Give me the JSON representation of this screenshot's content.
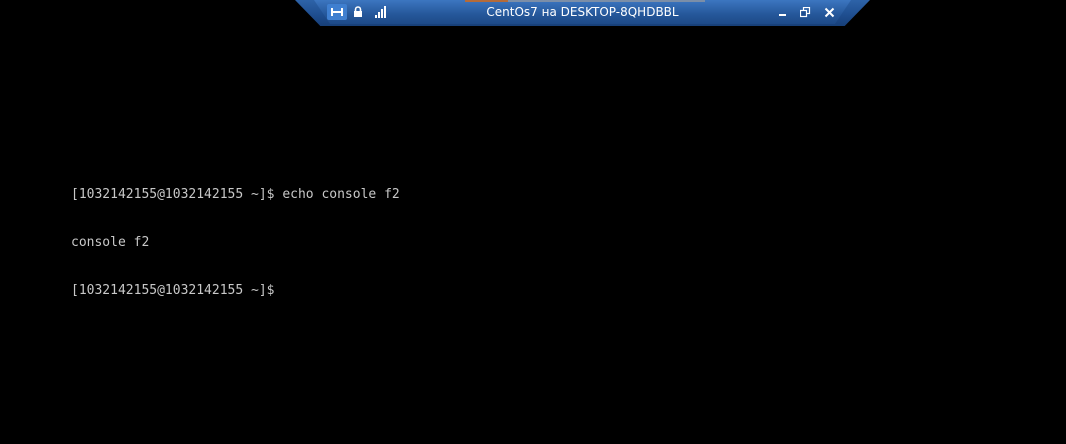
{
  "connection_bar": {
    "title": "CentOs7 на DESKTOP-8QHDBBL",
    "icons": [
      "pin-icon",
      "lock-icon",
      "signal-icon",
      "minimize-icon",
      "restore-icon",
      "close-icon"
    ],
    "colors": {
      "bar": "#1f4f91",
      "text": "#ffffff"
    }
  },
  "terminal": {
    "lines": [
      "[1032142155@1032142155 ~]$ echo console f2",
      "console f2",
      "[1032142155@1032142155 ~]$ "
    ],
    "colors": {
      "background": "#000000",
      "text": "#c8c8c8"
    }
  }
}
